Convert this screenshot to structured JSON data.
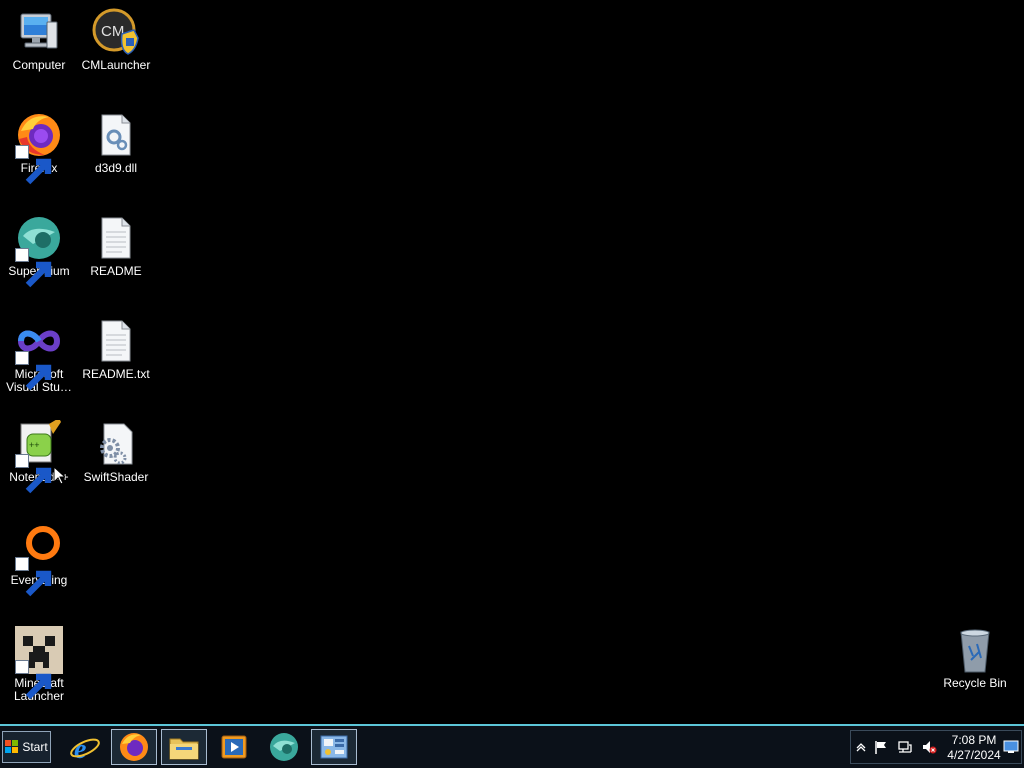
{
  "desktop": {
    "icons": [
      {
        "label": "Computer",
        "icon": "computer-icon",
        "shortcut": false
      },
      {
        "label": "CMLauncher",
        "icon": "cmlauncher-icon",
        "shortcut": false
      },
      {
        "label": "Firefox",
        "icon": "firefox-icon",
        "shortcut": true
      },
      {
        "label": "d3d9.dll",
        "icon": "dll-file-icon",
        "shortcut": false
      },
      {
        "label": "Supermium",
        "icon": "supermium-icon",
        "shortcut": true
      },
      {
        "label": "README",
        "icon": "text-file-icon",
        "shortcut": false
      },
      {
        "label": "Microsoft Visual Stu…",
        "icon": "visual-studio-icon",
        "shortcut": true
      },
      {
        "label": "README.txt",
        "icon": "text-file-icon",
        "shortcut": false
      },
      {
        "label": "Notepad++",
        "icon": "notepadpp-icon",
        "shortcut": true
      },
      {
        "label": "SwiftShader",
        "icon": "folder-settings-icon",
        "shortcut": false
      },
      {
        "label": "Everything",
        "icon": "everything-icon",
        "shortcut": true
      },
      {
        "label": "Minecraft Launcher",
        "icon": "minecraft-icon",
        "shortcut": true
      },
      {
        "label": "Recycle Bin",
        "icon": "recycle-bin-icon",
        "shortcut": false
      }
    ]
  },
  "taskbar": {
    "start_label": "Start",
    "pinned": [
      {
        "name": "internet-explorer",
        "icon": "ie-icon"
      },
      {
        "name": "firefox",
        "icon": "firefox-icon"
      },
      {
        "name": "file-explorer",
        "icon": "folder-icon"
      },
      {
        "name": "media-player",
        "icon": "media-player-icon"
      },
      {
        "name": "supermium",
        "icon": "supermium-icon"
      },
      {
        "name": "control-panel",
        "icon": "control-panel-icon"
      }
    ],
    "tray": {
      "icons": [
        "show-hidden-icons-icon",
        "action-center-flag-icon",
        "network-icon",
        "volume-muted-icon"
      ],
      "time": "7:08 PM",
      "date": "4/27/2024"
    }
  },
  "colors": {
    "desktop_background": "#000000",
    "taskbar_background": "#0b1119",
    "taskbar_accent": "#5cc6d8"
  }
}
